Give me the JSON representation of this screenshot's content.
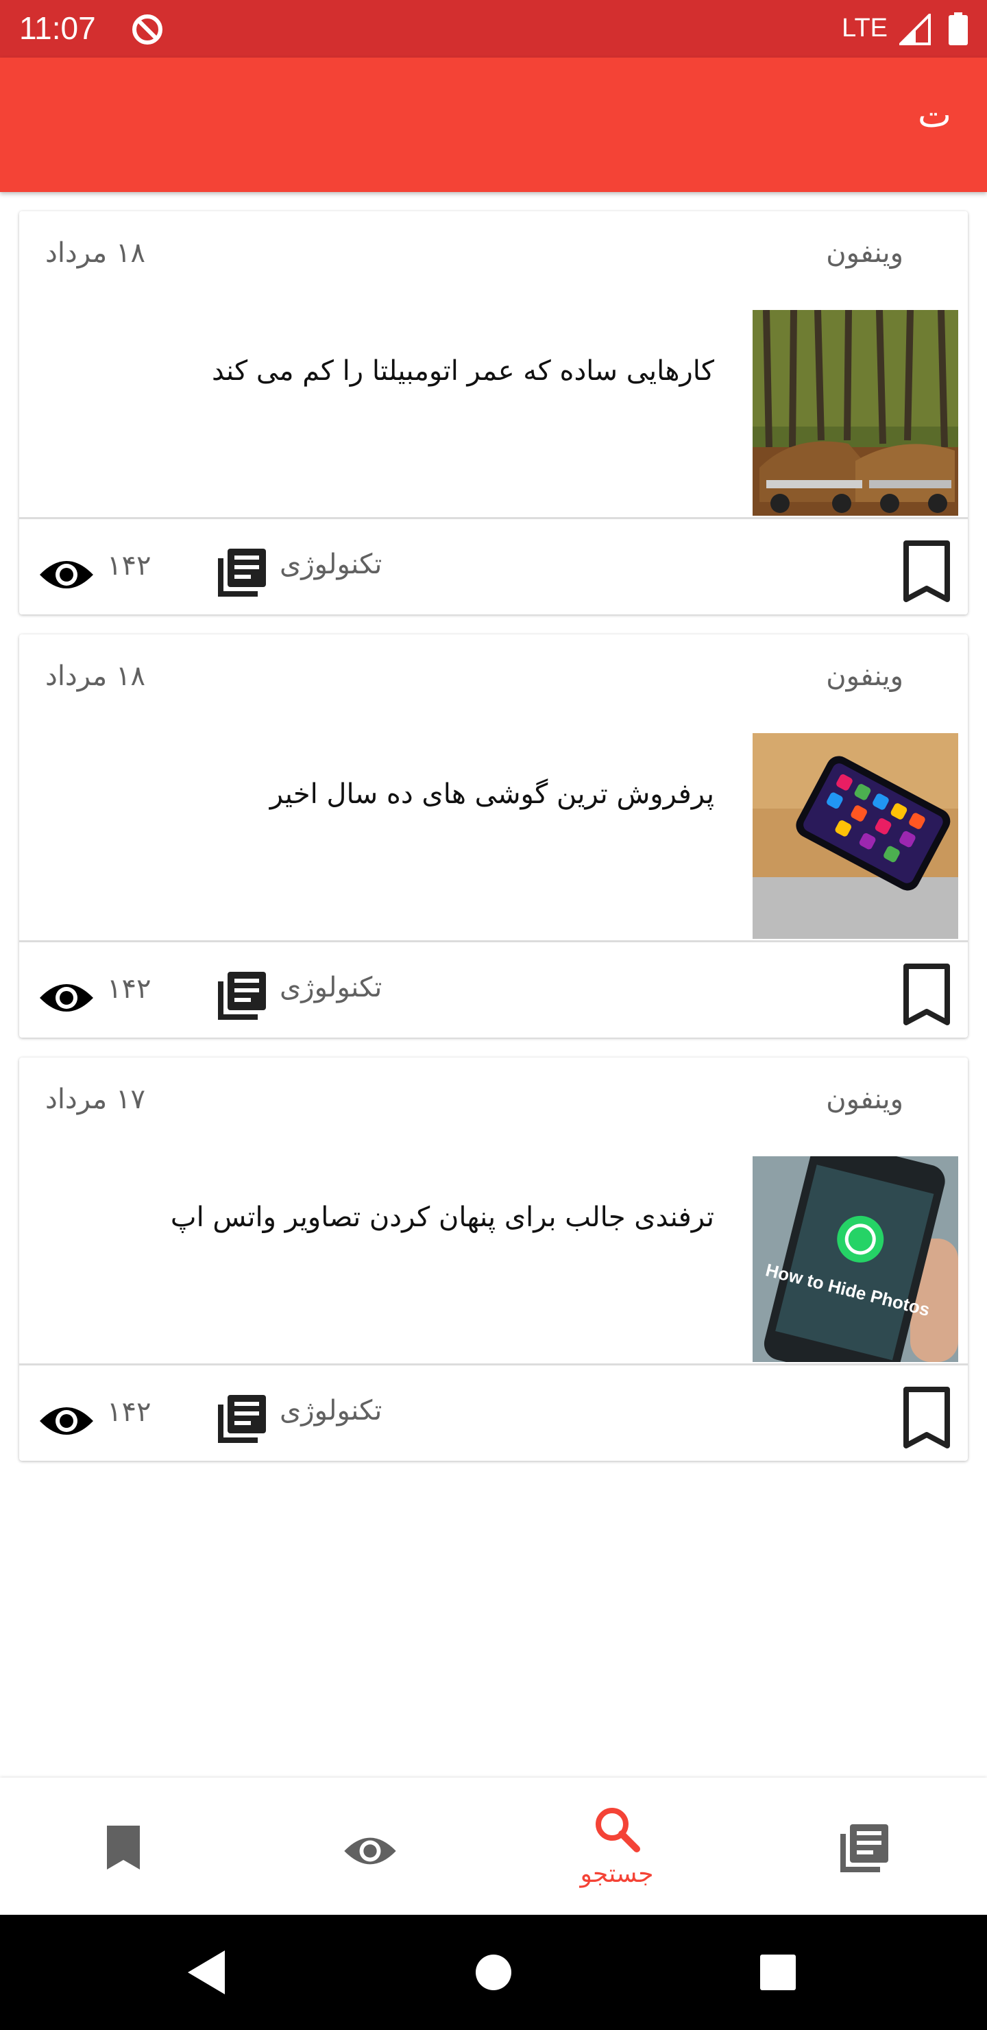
{
  "status_bar": {
    "time": "11:07",
    "network": "LTE"
  },
  "app_bar": {
    "title": "ت"
  },
  "articles": [
    {
      "source": "وینفون",
      "date": "۱۸ مرداد",
      "headline": "کارهایی ساده که عمر اتومبیلتا را کم می کند",
      "category": "تکنولوژی",
      "views": "۱۴۲",
      "thumbnail": "abandoned-cars-forest"
    },
    {
      "source": "وینفون",
      "date": "۱۸ مرداد",
      "headline": "پرفروش ترین گوشی های ده سال اخیر",
      "category": "تکنولوژی",
      "views": "۱۴۲",
      "thumbnail": "smartphone-on-table"
    },
    {
      "source": "وینفون",
      "date": "۱۷ مرداد",
      "headline": "ترفندی جالب برای پنهان کردن تصاویر واتس اپ",
      "category": "تکنولوژی",
      "views": "۱۴۲",
      "thumbnail": "whatsapp-phone",
      "thumbnail_text": "How to Hide Photos"
    }
  ],
  "bottom_nav": {
    "items": [
      {
        "icon": "bookmark-icon",
        "label": ""
      },
      {
        "icon": "eye-icon",
        "label": ""
      },
      {
        "icon": "search-icon",
        "label": "جستجو",
        "active": true
      },
      {
        "icon": "news-icon",
        "label": ""
      }
    ]
  },
  "colors": {
    "accent": "#f44336",
    "status_bar": "#d32f2f",
    "icon_dark": "#212121",
    "icon_nav": "#616161"
  }
}
